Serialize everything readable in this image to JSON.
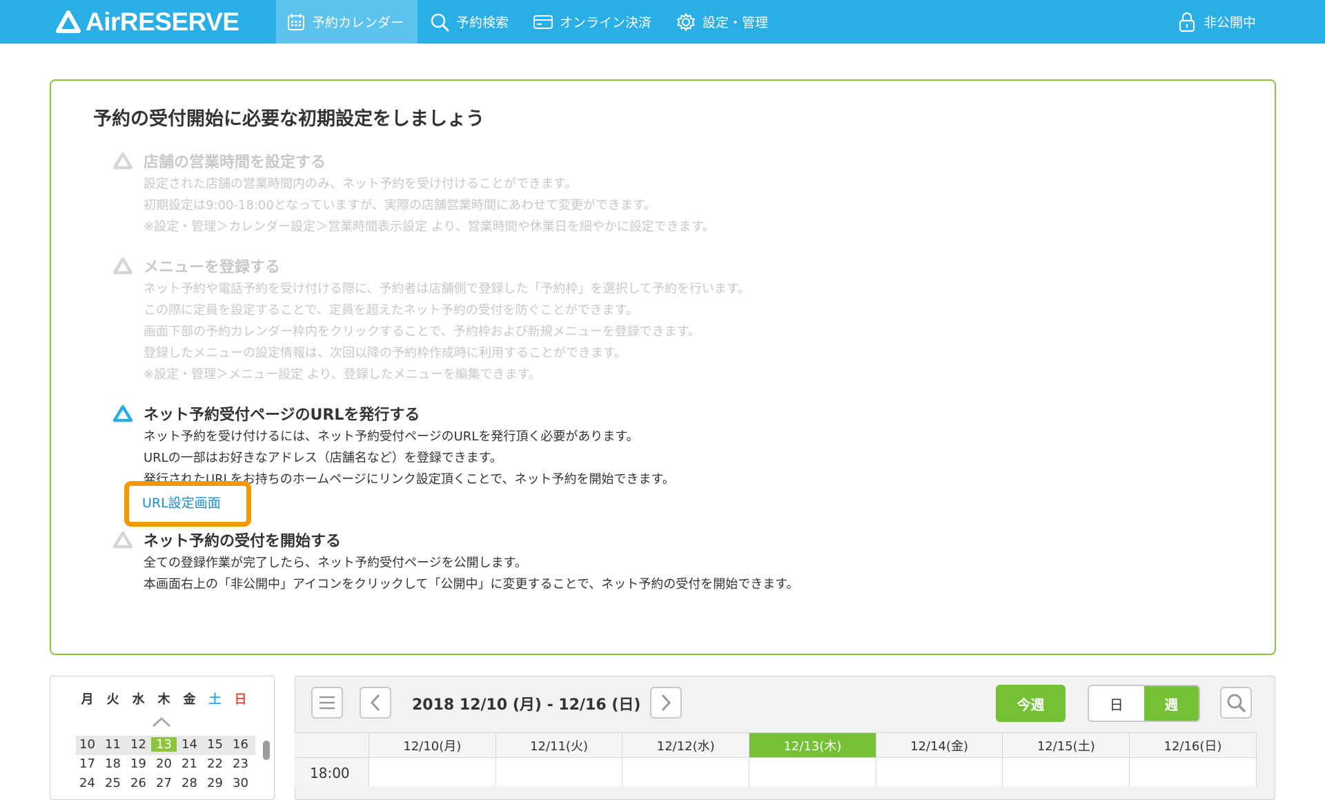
{
  "header": {
    "brand": "AirRESERVE",
    "nav": [
      {
        "label": "予約カレンダー",
        "icon": "calendar-icon",
        "active": true
      },
      {
        "label": "予約検索",
        "icon": "search-icon",
        "active": false
      },
      {
        "label": "オンライン決済",
        "icon": "card-icon",
        "active": false
      },
      {
        "label": "設定・管理",
        "icon": "gear-icon",
        "active": false
      }
    ],
    "status": {
      "label": "非公開中",
      "icon": "lock-icon"
    }
  },
  "setup": {
    "title": "予約の受付開始に必要な初期設定をしましょう",
    "steps": [
      {
        "state": "done",
        "title": "店舗の営業時間を設定する",
        "lines": [
          "設定された店舗の営業時間内のみ、ネット予約を受け付けることができます。",
          "初期設定は9:00-18:00となっていますが、実際の店舗営業時間にあわせて変更ができます。",
          "※設定・管理＞カレンダー設定＞営業時間表示設定 より、営業時間や休業日を細やかに設定できます。"
        ]
      },
      {
        "state": "done",
        "title": "メニューを登録する",
        "lines": [
          "ネット予約や電話予約を受け付ける際に、予約者は店舗側で登録した「予約枠」を選択して予約を行います。",
          "この際に定員を設定することで、定員を超えたネット予約の受付を防ぐことができます。",
          "画面下部の予約カレンダー枠内をクリックすることで、予約枠および新規メニューを登録できます。",
          "登録したメニューの設定情報は、次回以降の予約枠作成時に利用することができます。",
          "※設定・管理＞メニュー設定 より、登録したメニューを編集できます。"
        ]
      },
      {
        "state": "current",
        "title": "ネット予約受付ページのURLを発行する",
        "lines": [
          "ネット予約を受け付けるには、ネット予約受付ページのURLを発行頂く必要があります。",
          "URLの一部はお好きなアドレス（店舗名など）を登録できます。",
          "発行されたURLをお持ちのホームページにリンク設定頂くことで、ネット予約を開始できます。"
        ],
        "link": "URL設定画面"
      },
      {
        "state": "todo",
        "title": "ネット予約の受付を開始する",
        "lines": [
          "全ての登録作業が完了したら、ネット予約受付ページを公開します。",
          "本画面右上の「非公開中」アイコンをクリックして「公開中」に変更することで、ネット予約の受付を開始できます。"
        ]
      }
    ],
    "colors": {
      "done": "#c8c8c8",
      "current": "#29aee6",
      "accent_border": "#8cc63f",
      "highlight": "#f39800"
    }
  },
  "mini_calendar": {
    "weekdays": [
      "月",
      "火",
      "水",
      "木",
      "金",
      "土",
      "日"
    ],
    "weeks": [
      [
        "10",
        "11",
        "12",
        "13",
        "14",
        "15",
        "16"
      ],
      [
        "17",
        "18",
        "19",
        "20",
        "21",
        "22",
        "23"
      ],
      [
        "24",
        "25",
        "26",
        "27",
        "28",
        "29",
        "30"
      ]
    ],
    "today": "13"
  },
  "calendar": {
    "range": "2018 12/10 (月) - 12/16 (日)",
    "this_week_label": "今週",
    "view_day": "日",
    "view_week": "週",
    "days": [
      "12/10(月)",
      "12/11(火)",
      "12/12(水)",
      "12/13(木)",
      "12/14(金)",
      "12/15(土)",
      "12/16(日)"
    ],
    "today_index": 3,
    "first_time": "18:00"
  }
}
